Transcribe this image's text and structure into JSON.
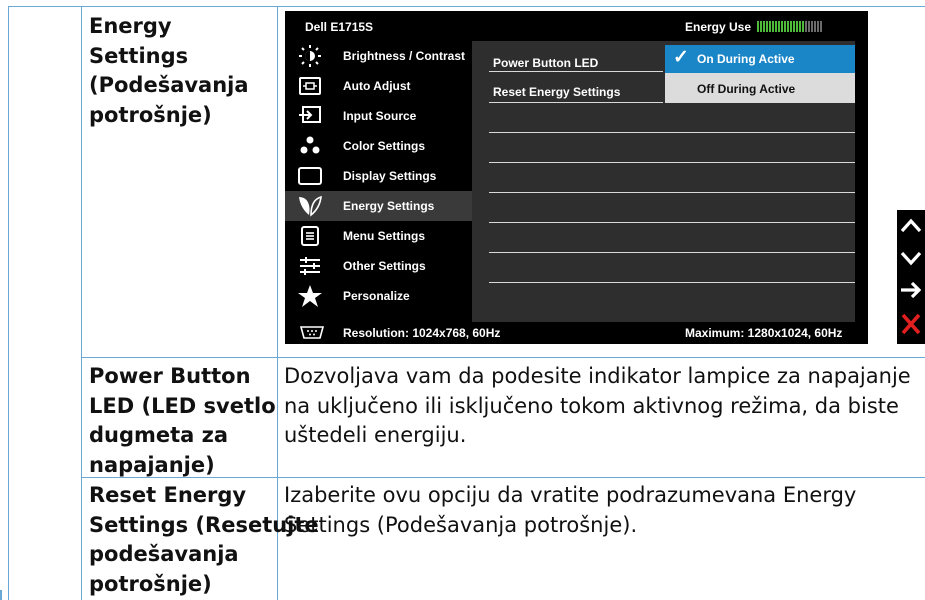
{
  "rows": [
    {
      "label_lines": [
        "Energy Settings",
        "(Podešavanja",
        "potrošnje)"
      ],
      "desc_lines": []
    },
    {
      "label_lines": [
        "Power Button",
        "LED (LED svetlo",
        "dugmeta za",
        "napajanje)"
      ],
      "desc_lines": [
        "Dozvoljava vam da podesite indikator lampice za napajanje",
        "na uključeno ili isključeno tokom aktivnog režima, da biste",
        "uštedeli energiju."
      ]
    },
    {
      "label_lines": [
        "Reset Energy",
        "Settings (Resetujte",
        "podešavanja",
        "potrošnje)"
      ],
      "desc_lines": [
        "Izaberite ovu opciju da vratite podrazumevana Energy",
        "Settings (Podešavanja potrošnje)."
      ]
    }
  ],
  "osd": {
    "model": "Dell E1715S",
    "energy_use_label": "Energy Use",
    "energy_level": 0.72,
    "menu": [
      {
        "label": "Brightness / Contrast",
        "icon": "brightness-icon"
      },
      {
        "label": "Auto Adjust",
        "icon": "auto-adjust-icon"
      },
      {
        "label": "Input Source",
        "icon": "input-source-icon"
      },
      {
        "label": "Color Settings",
        "icon": "color-settings-icon"
      },
      {
        "label": "Display Settings",
        "icon": "display-settings-icon"
      },
      {
        "label": "Energy Settings",
        "icon": "energy-leaf-icon"
      },
      {
        "label": "Menu Settings",
        "icon": "menu-settings-icon"
      },
      {
        "label": "Other Settings",
        "icon": "other-settings-icon"
      },
      {
        "label": "Personalize",
        "icon": "star-icon"
      }
    ],
    "submenu": [
      {
        "label": "Power Button LED"
      },
      {
        "label": "Reset Energy Settings"
      }
    ],
    "options": [
      {
        "label": "On During Active",
        "selected": true,
        "check": "✓"
      },
      {
        "label": "Off During Active",
        "selected": false
      }
    ],
    "resolution": "Resolution: 1024x768, 60Hz",
    "maximum": "Maximum: 1280x1024, 60Hz",
    "accent_color": "#1a86c8",
    "energy_bar_color": "#4fbb3a"
  },
  "nav_buttons": [
    {
      "name": "up-arrow-icon",
      "glyph": "∧"
    },
    {
      "name": "down-arrow-icon",
      "glyph": "∨"
    },
    {
      "name": "enter-arrow-icon",
      "glyph": "→"
    },
    {
      "name": "exit-x-icon",
      "glyph": "✕"
    }
  ]
}
